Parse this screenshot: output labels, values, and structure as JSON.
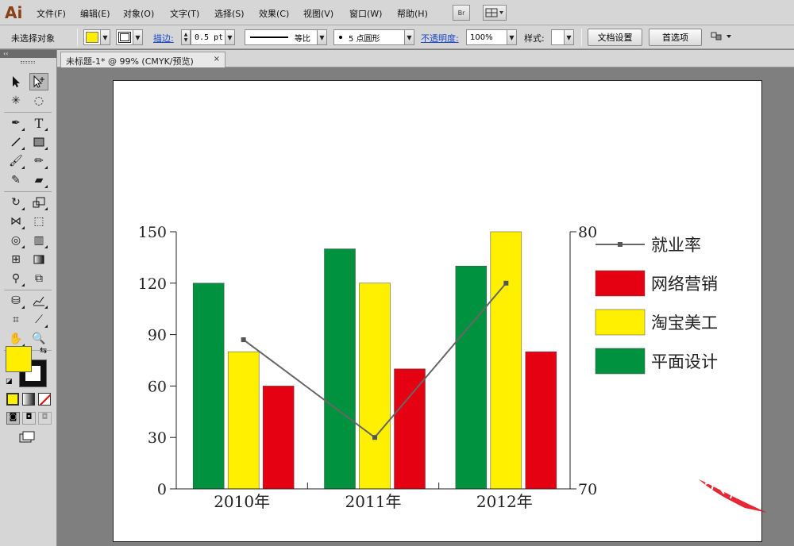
{
  "app": {
    "logo": "Ai"
  },
  "menu": [
    {
      "label": "文件(F)"
    },
    {
      "label": "编辑(E)"
    },
    {
      "label": "对象(O)"
    },
    {
      "label": "文字(T)"
    },
    {
      "label": "选择(S)"
    },
    {
      "label": "效果(C)"
    },
    {
      "label": "视图(V)"
    },
    {
      "label": "窗口(W)"
    },
    {
      "label": "帮助(H)"
    }
  ],
  "menu_buttons": {
    "bridge": "Br"
  },
  "controlbar": {
    "selection_status": "未选择对象",
    "fill_color": "#ffee00",
    "stroke_label": "描边:",
    "stroke_weight": "0.5 pt",
    "stroke_profile": "等比",
    "brush_size": "5 点圆形",
    "opacity_label": "不透明度:",
    "opacity_value": "100%",
    "style_label": "样式:",
    "doc_setup_button": "文档设置",
    "preferences_button": "首选项"
  },
  "tools_panel": {
    "collapse_label": "‹‹"
  },
  "document": {
    "tab_title": "未标题-1* @ 99% (CMYK/预览)",
    "tab_close": "×"
  },
  "colors": {
    "fill": "#ffee00",
    "series_green": "#00923f",
    "series_yellow": "#fff000",
    "series_red": "#e50012",
    "line": "#666666"
  },
  "chart_data": {
    "type": "bar",
    "categories": [
      "2010年",
      "2011年",
      "2012年"
    ],
    "series": [
      {
        "name": "平面设计",
        "values": [
          120,
          140,
          130
        ],
        "color": "#00923f"
      },
      {
        "name": "淘宝美工",
        "values": [
          80,
          120,
          150
        ],
        "color": "#fff000"
      },
      {
        "name": "网络营销",
        "values": [
          60,
          70,
          80
        ],
        "color": "#e50012"
      }
    ],
    "line_series": {
      "name": "就业率",
      "values": [
        75.8,
        72.0,
        78.0
      ],
      "axis": "right",
      "color": "#666666"
    },
    "y_left": {
      "min": 0,
      "max": 150,
      "ticks": [
        "0",
        "30",
        "60",
        "90",
        "120",
        "150"
      ]
    },
    "y_right": {
      "min": 70,
      "max": 80,
      "ticks": [
        "70",
        "80"
      ]
    },
    "legend": {
      "position": "right",
      "entries": [
        "就业率",
        "网络营销",
        "淘宝美工",
        "平面设计"
      ]
    },
    "grid": false
  }
}
